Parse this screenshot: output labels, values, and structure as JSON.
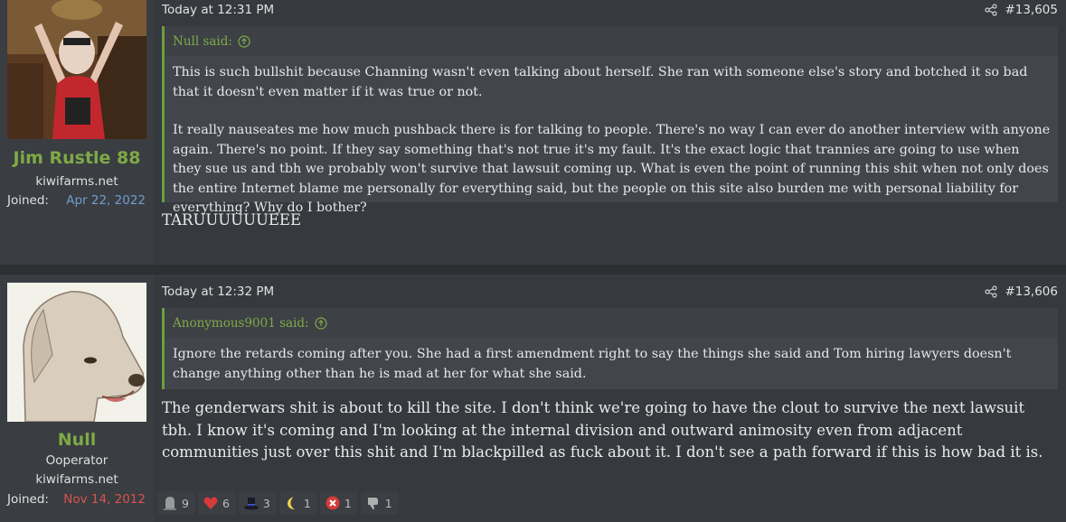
{
  "posts": [
    {
      "author": "Jim Rustle 88",
      "user_title": "kiwifarms.net",
      "joined_label": "Joined:",
      "joined_date": "Apr 22, 2022",
      "time": "Today at 12:31 PM",
      "post_number": "#13,605",
      "quote": {
        "header": "Null said:",
        "paragraphs": [
          "This is such bullshit because Channing wasn't even talking about herself. She ran with someone else's story and botched it so bad that it doesn't even matter if it was true or not.",
          "It really nauseates me how much pushback there is for talking to people. There's no way I can ever do another interview with anyone again. There's no point. If they say something that's not true it's my fault. It's the exact logic that trannies are going to use when they sue us and tbh we probably won't survive that lawsuit coming up. What is even the point of running this shit when not only does the entire Internet blame me personally for everything said, but the people on this site also burden me with personal liability for everything? Why do I bother?"
        ]
      },
      "text": "TARUUUUUUEEE"
    },
    {
      "author": "Null",
      "user_title": "Ooperator",
      "user_site": "kiwifarms.net",
      "joined_label": "Joined:",
      "joined_date": "Nov 14, 2012",
      "time": "Today at 12:32 PM",
      "post_number": "#13,606",
      "quote": {
        "header": "Anonymous9001 said:",
        "paragraphs": [
          "Ignore the retards coming after you. She had a first amendment right to say the things she said and Tom hiring lawyers doesn't change anything other than he is mad at her for what she said."
        ]
      },
      "text": "The genderwars shit is about to kill the site. I don't think we're going to have the clout to survive the next lawsuit tbh. I know it's coming and I'm looking at the internal division and outward animosity even from adjacent communities just over this shit and I'm blackpilled as fuck about it. I don't see a path forward if this is how bad it is.",
      "reactions": [
        {
          "icon": "tombstone-icon",
          "count": "9"
        },
        {
          "icon": "heart-icon",
          "count": "6"
        },
        {
          "icon": "top-hat-icon",
          "count": "3"
        },
        {
          "icon": "moon-icon",
          "count": "1"
        },
        {
          "icon": "x-mark-icon",
          "count": "1"
        },
        {
          "icon": "thumbs-down-icon",
          "count": "1"
        }
      ]
    }
  ],
  "colors": {
    "username": "#7eaa46",
    "joined_blue": "#6f9fcf",
    "joined_red": "#d9534f"
  }
}
